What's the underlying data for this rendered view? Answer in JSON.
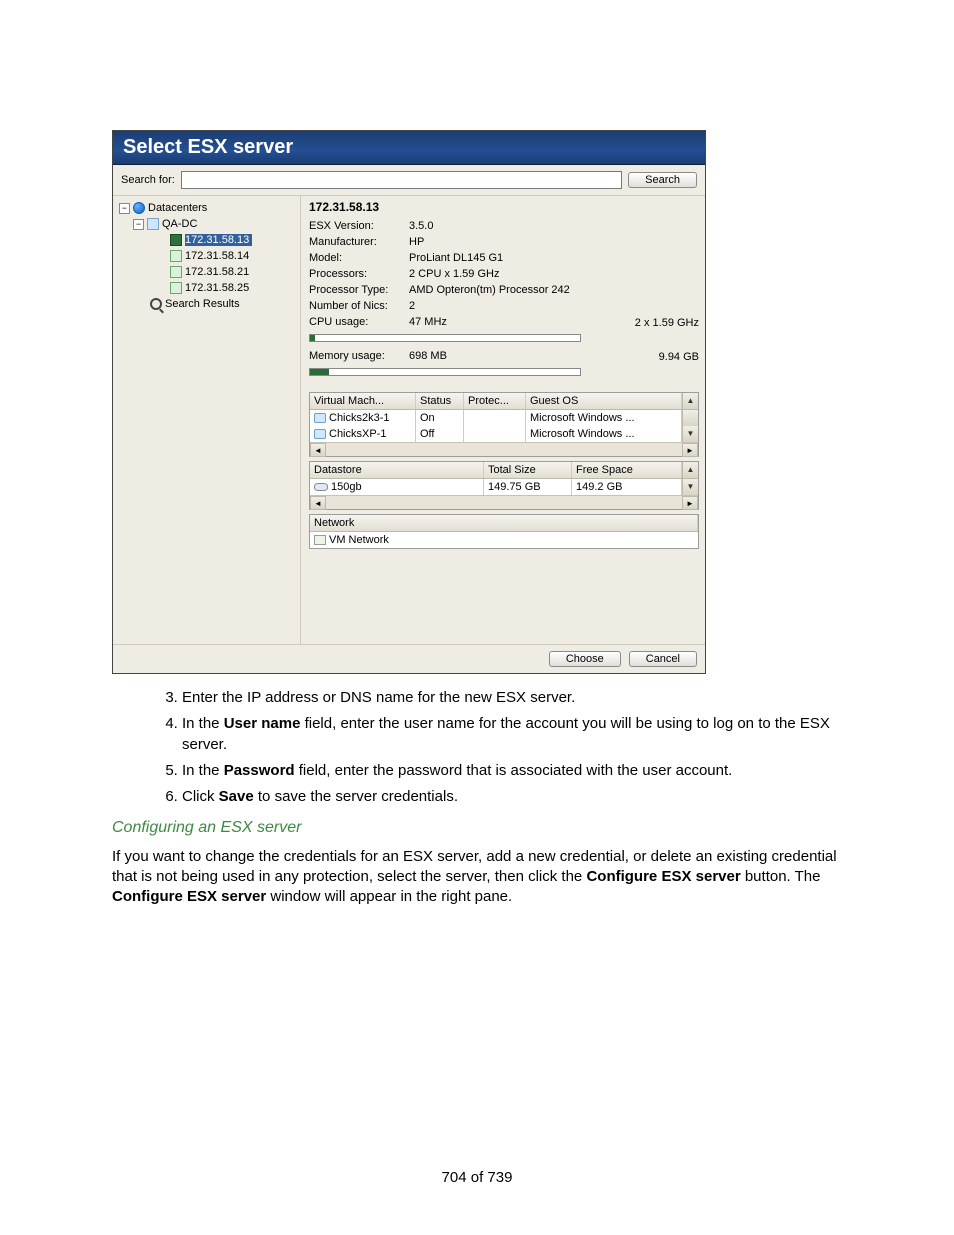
{
  "dialog": {
    "title": "Select ESX server",
    "search_label": "Search for:",
    "search_value": "",
    "search_button": "Search",
    "tree": {
      "root": "Datacenters",
      "dc": "QA-DC",
      "hosts": [
        "172.31.58.13",
        "172.31.58.14",
        "172.31.58.21",
        "172.31.58.25"
      ],
      "results": "Search Results",
      "selected_host": "172.31.58.13"
    },
    "details": {
      "heading": "172.31.58.13",
      "rows": [
        {
          "k": "ESX Version:",
          "v": "3.5.0"
        },
        {
          "k": "Manufacturer:",
          "v": "HP"
        },
        {
          "k": "Model:",
          "v": "ProLiant DL145 G1"
        },
        {
          "k": "Processors:",
          "v": "2 CPU x 1.59 GHz"
        },
        {
          "k": "Processor Type:",
          "v": "AMD Opteron(tm) Processor 242"
        },
        {
          "k": "Number of Nics:",
          "v": "2"
        }
      ],
      "cpu": {
        "label": "CPU usage:",
        "value": "47 MHz",
        "max": "2 x 1.59 GHz",
        "fill_pct": 2
      },
      "mem": {
        "label": "Memory usage:",
        "value": "698 MB",
        "max": "9.94 GB",
        "fill_pct": 7
      }
    },
    "vm_grid": {
      "headers": [
        "Virtual Mach...",
        "Status",
        "Protec...",
        "Guest OS"
      ],
      "rows": [
        {
          "name": "Chicks2k3-1",
          "status": "On",
          "protec": "",
          "guest": "Microsoft Windows ..."
        },
        {
          "name": "ChicksXP-1",
          "status": "Off",
          "protec": "",
          "guest": "Microsoft Windows ..."
        }
      ]
    },
    "ds_grid": {
      "headers": [
        "Datastore",
        "Total Size",
        "Free Space"
      ],
      "rows": [
        {
          "name": "150gb",
          "total": "149.75 GB",
          "free": "149.2 GB"
        }
      ]
    },
    "net_grid": {
      "header": "Network",
      "row": "VM Network"
    },
    "footer": {
      "choose": "Choose",
      "cancel": "Cancel"
    }
  },
  "doc": {
    "step3": "Enter the IP address or DNS name for the new ESX server.",
    "step4_pre": "In the ",
    "step4_b": "User name",
    "step4_post": " field, enter the user name for the account you will be using to log on to the ESX server.",
    "step5_pre": "In the ",
    "step5_b": "Password",
    "step5_post": " field, enter the password that is associated with the user account.",
    "step6_pre": "Click ",
    "step6_b": "Save",
    "step6_post": " to save the server credentials.",
    "subhead": "Configuring an ESX server",
    "para_pre": "If you want to change the credentials for an ESX server, add a new credential, or delete an existing credential that is not being used in any protection, select the server, then click the ",
    "para_b1": "Configure ESX server",
    "para_mid": " button. The ",
    "para_b2": "Configure ESX server",
    "para_post": " window will appear in the right pane.",
    "pagenum": "704 of 739"
  },
  "chart_data": {
    "type": "bar",
    "title": "ESX host utilisation meters",
    "series": [
      {
        "name": "CPU usage",
        "value_label": "47 MHz",
        "max_label": "2 x 1.59 GHz",
        "fill_percent": 2
      },
      {
        "name": "Memory usage",
        "value_label": "698 MB",
        "max_label": "9.94 GB",
        "fill_percent": 7
      }
    ]
  }
}
